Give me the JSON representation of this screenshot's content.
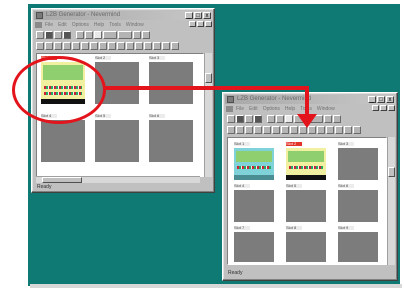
{
  "windows": [
    {
      "title": "LZB Generator - Nevermind",
      "menus": [
        "File",
        "Edit",
        "Options",
        "Help",
        "Tools",
        "Window"
      ],
      "controls": [
        "_",
        "□",
        "x"
      ],
      "status": "Ready",
      "cells": [
        {
          "label": "Slot 1",
          "kind": "game",
          "highlighted": true
        },
        {
          "label": "Slot 2",
          "kind": "empty"
        },
        {
          "label": "Slot 3",
          "kind": "empty"
        },
        {
          "label": "Slot 4",
          "kind": "empty"
        },
        {
          "label": "Slot 5",
          "kind": "empty"
        },
        {
          "label": "Slot 6",
          "kind": "empty"
        }
      ]
    },
    {
      "title": "LZB Generator - Nevermind",
      "menus": [
        "File",
        "Edit",
        "Options",
        "Help",
        "Tools",
        "Window"
      ],
      "controls": [
        "_",
        "□",
        "x"
      ],
      "status": "Ready",
      "cells": [
        {
          "label": "Slot 1",
          "kind": "game-alt"
        },
        {
          "label": "Slot 2",
          "kind": "game",
          "highlighted": true
        },
        {
          "label": "Slot 3",
          "kind": "empty"
        },
        {
          "label": "Slot 4",
          "kind": "empty"
        },
        {
          "label": "Slot 5",
          "kind": "empty"
        },
        {
          "label": "Slot 6",
          "kind": "empty"
        },
        {
          "label": "Slot 7",
          "kind": "empty"
        },
        {
          "label": "Slot 8",
          "kind": "empty"
        },
        {
          "label": "Slot 9",
          "kind": "empty"
        }
      ]
    }
  ],
  "annotation": {
    "color": "#e3141b"
  },
  "colors": {
    "desktop": "#0e7a73",
    "window": "#c0c0c0",
    "slot_highlight": "#e3342a"
  }
}
